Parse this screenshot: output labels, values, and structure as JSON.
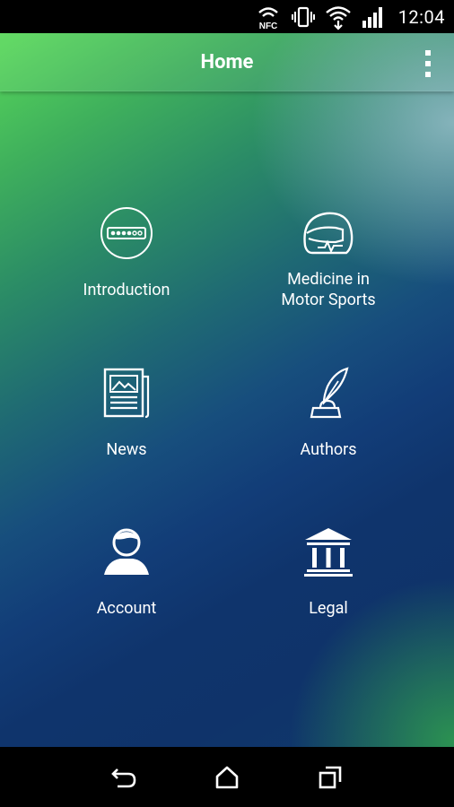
{
  "status_bar": {
    "time": "12:04",
    "icons": [
      "nfc-icon",
      "vibrate-icon",
      "wifi-icon",
      "signal-icon"
    ],
    "nfc_label": "NFC"
  },
  "app_bar": {
    "title": "Home",
    "overflow_icon": "more-vert-icon"
  },
  "menu": {
    "items": [
      {
        "label": "Introduction",
        "icon": "slides-icon"
      },
      {
        "label": "Medicine in\nMotor Sports",
        "icon": "helmet-icon"
      },
      {
        "label": "News",
        "icon": "newspaper-icon"
      },
      {
        "label": "Authors",
        "icon": "quill-icon"
      },
      {
        "label": "Account",
        "icon": "user-icon"
      },
      {
        "label": "Legal",
        "icon": "courthouse-icon"
      }
    ]
  },
  "nav_bar": {
    "icons": [
      "back-icon",
      "home-icon",
      "recents-icon"
    ]
  },
  "colors": {
    "gradient_top_left": "#59d95a",
    "gradient_middle": "#123d78",
    "icon_color": "#ffffff"
  }
}
